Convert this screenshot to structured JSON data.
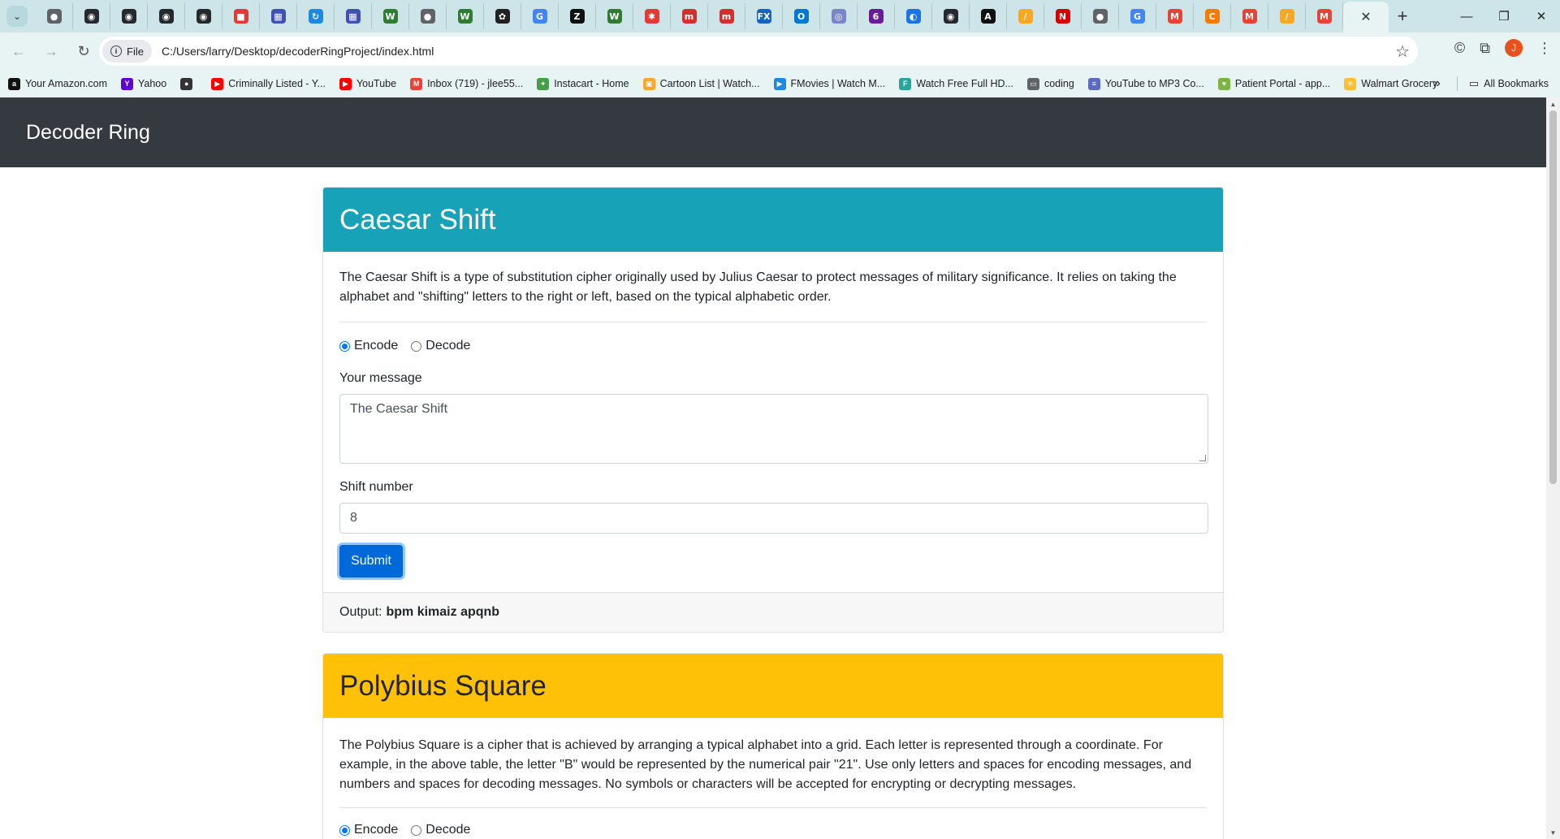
{
  "browser": {
    "tab_favicons": [
      {
        "name": "globe-icon",
        "color": "#5f6368",
        "glyph": "●"
      },
      {
        "name": "github-icon",
        "color": "#24292e",
        "glyph": "◉"
      },
      {
        "name": "github-icon",
        "color": "#24292e",
        "glyph": "◉"
      },
      {
        "name": "github-icon",
        "color": "#24292e",
        "glyph": "◉"
      },
      {
        "name": "github-icon",
        "color": "#24292e",
        "glyph": "◉"
      },
      {
        "name": "record-icon",
        "color": "#e53935",
        "glyph": "■"
      },
      {
        "name": "app-icon",
        "color": "#3f51b5",
        "glyph": "▦"
      },
      {
        "name": "loop-icon",
        "color": "#1e88e5",
        "glyph": "↻"
      },
      {
        "name": "app-icon",
        "color": "#3f51b5",
        "glyph": "▦"
      },
      {
        "name": "w-icon",
        "color": "#2e7d32",
        "glyph": "W"
      },
      {
        "name": "globe-icon",
        "color": "#5f6368",
        "glyph": "●"
      },
      {
        "name": "w-icon",
        "color": "#2e7d32",
        "glyph": "W"
      },
      {
        "name": "openai-icon",
        "color": "#202124",
        "glyph": "✿"
      },
      {
        "name": "google-icon",
        "color": "#4285f4",
        "glyph": "G"
      },
      {
        "name": "zoom-icon",
        "color": "#111111",
        "glyph": "Z"
      },
      {
        "name": "w-icon",
        "color": "#2e7d32",
        "glyph": "W"
      },
      {
        "name": "asterisk-icon",
        "color": "#e53935",
        "glyph": "✱"
      },
      {
        "name": "m-icon",
        "color": "#d32f2f",
        "glyph": "m"
      },
      {
        "name": "m-icon",
        "color": "#d32f2f",
        "glyph": "m"
      },
      {
        "name": "fx-icon",
        "color": "#1565c0",
        "glyph": "FX"
      },
      {
        "name": "outlook-icon",
        "color": "#0078d4",
        "glyph": "O"
      },
      {
        "name": "circle-icon",
        "color": "#7986cb",
        "glyph": "◎"
      },
      {
        "name": "badge-icon",
        "color": "#6a1b9a",
        "glyph": "6"
      },
      {
        "name": "edge-icon",
        "color": "#1a73e8",
        "glyph": "◐"
      },
      {
        "name": "github-icon",
        "color": "#24292e",
        "glyph": "◉"
      },
      {
        "name": "a-icon",
        "color": "#111111",
        "glyph": "A"
      },
      {
        "name": "chart-icon",
        "color": "#f9a825",
        "glyph": "∕"
      },
      {
        "name": "n-icon",
        "color": "#d50000",
        "glyph": "N"
      },
      {
        "name": "globe-icon",
        "color": "#5f6368",
        "glyph": "●"
      },
      {
        "name": "google-icon",
        "color": "#4285f4",
        "glyph": "G"
      },
      {
        "name": "gmail-icon",
        "color": "#ea4335",
        "glyph": "M"
      },
      {
        "name": "c-icon",
        "color": "#f57c00",
        "glyph": "C"
      },
      {
        "name": "gmail-icon",
        "color": "#ea4335",
        "glyph": "M"
      },
      {
        "name": "chart-icon",
        "color": "#f9a825",
        "glyph": "∕"
      },
      {
        "name": "gmail-icon",
        "color": "#ea4335",
        "glyph": "M"
      }
    ],
    "address": {
      "chip_label": "File",
      "url": "C:/Users/larry/Desktop/decoderRingProject/index.html"
    },
    "profile_initial": "J",
    "bookmarks": [
      {
        "label": "Your Amazon.com",
        "icon": "amazon-icon",
        "color": "#111111",
        "glyph": "a"
      },
      {
        "label": "Yahoo",
        "icon": "yahoo-icon",
        "color": "#6001d2",
        "glyph": "Y"
      },
      {
        "label": "",
        "icon": "globe-icon",
        "color": "#333333",
        "glyph": "●"
      },
      {
        "label": "Criminally Listed - Y...",
        "icon": "youtube-icon",
        "color": "#ff0000",
        "glyph": "▶"
      },
      {
        "label": "YouTube",
        "icon": "youtube-icon",
        "color": "#ff0000",
        "glyph": "▶"
      },
      {
        "label": "Inbox (719) - jlee55...",
        "icon": "gmail-icon",
        "color": "#ea4335",
        "glyph": "M"
      },
      {
        "label": "Instacart - Home",
        "icon": "carrot-icon",
        "color": "#43a047",
        "glyph": "✦"
      },
      {
        "label": "Cartoon List | Watch...",
        "icon": "folder-icon",
        "color": "#f9a825",
        "glyph": "▣"
      },
      {
        "label": "FMovies | Watch M...",
        "icon": "play-icon",
        "color": "#1e88e5",
        "glyph": "▶"
      },
      {
        "label": "Watch Free Full HD...",
        "icon": "film-icon",
        "color": "#26a69a",
        "glyph": "F"
      },
      {
        "label": "coding",
        "icon": "folder-icon",
        "color": "#5f6368",
        "glyph": "▭"
      },
      {
        "label": "YouTube to MP3 Co...",
        "icon": "convert-icon",
        "color": "#5c6bc0",
        "glyph": "≡"
      },
      {
        "label": "Patient Portal - app...",
        "icon": "leaf-icon",
        "color": "#7cb342",
        "glyph": "♥"
      },
      {
        "label": "Walmart Grocery",
        "icon": "walmart-icon",
        "color": "#fbc02d",
        "glyph": "✳"
      }
    ],
    "all_bookmarks_label": "All Bookmarks"
  },
  "navbar": {
    "brand": "Decoder Ring"
  },
  "caesar": {
    "title": "Caesar Shift",
    "header_color": "#17a2b8",
    "description": "The Caesar Shift is a type of substitution cipher originally used by Julius Caesar to protect messages of military significance. It relies on taking the alphabet and \"shifting\" letters to the right or left, based on the typical alphabetic order.",
    "encode_label": "Encode",
    "decode_label": "Decode",
    "selected_mode": "Encode",
    "message_label": "Your message",
    "message_value": "The Caesar Shift",
    "shift_label": "Shift number",
    "shift_value": "8",
    "submit_label": "Submit",
    "output_label": "Output:",
    "output_value": "bpm kimaiz apqnb"
  },
  "polybius": {
    "title": "Polybius Square",
    "header_color": "#ffc107",
    "description": "The Polybius Square is a cipher that is achieved by arranging a typical alphabet into a grid. Each letter is represented through a coordinate. For example, in the above table, the letter \"B\" would be represented by the numerical pair \"21\". Use only letters and spaces for encoding messages, and numbers and spaces for decoding messages. No symbols or characters will be accepted for encrypting or decrypting messages.",
    "encode_label": "Encode",
    "decode_label": "Decode",
    "selected_mode": "Encode"
  }
}
